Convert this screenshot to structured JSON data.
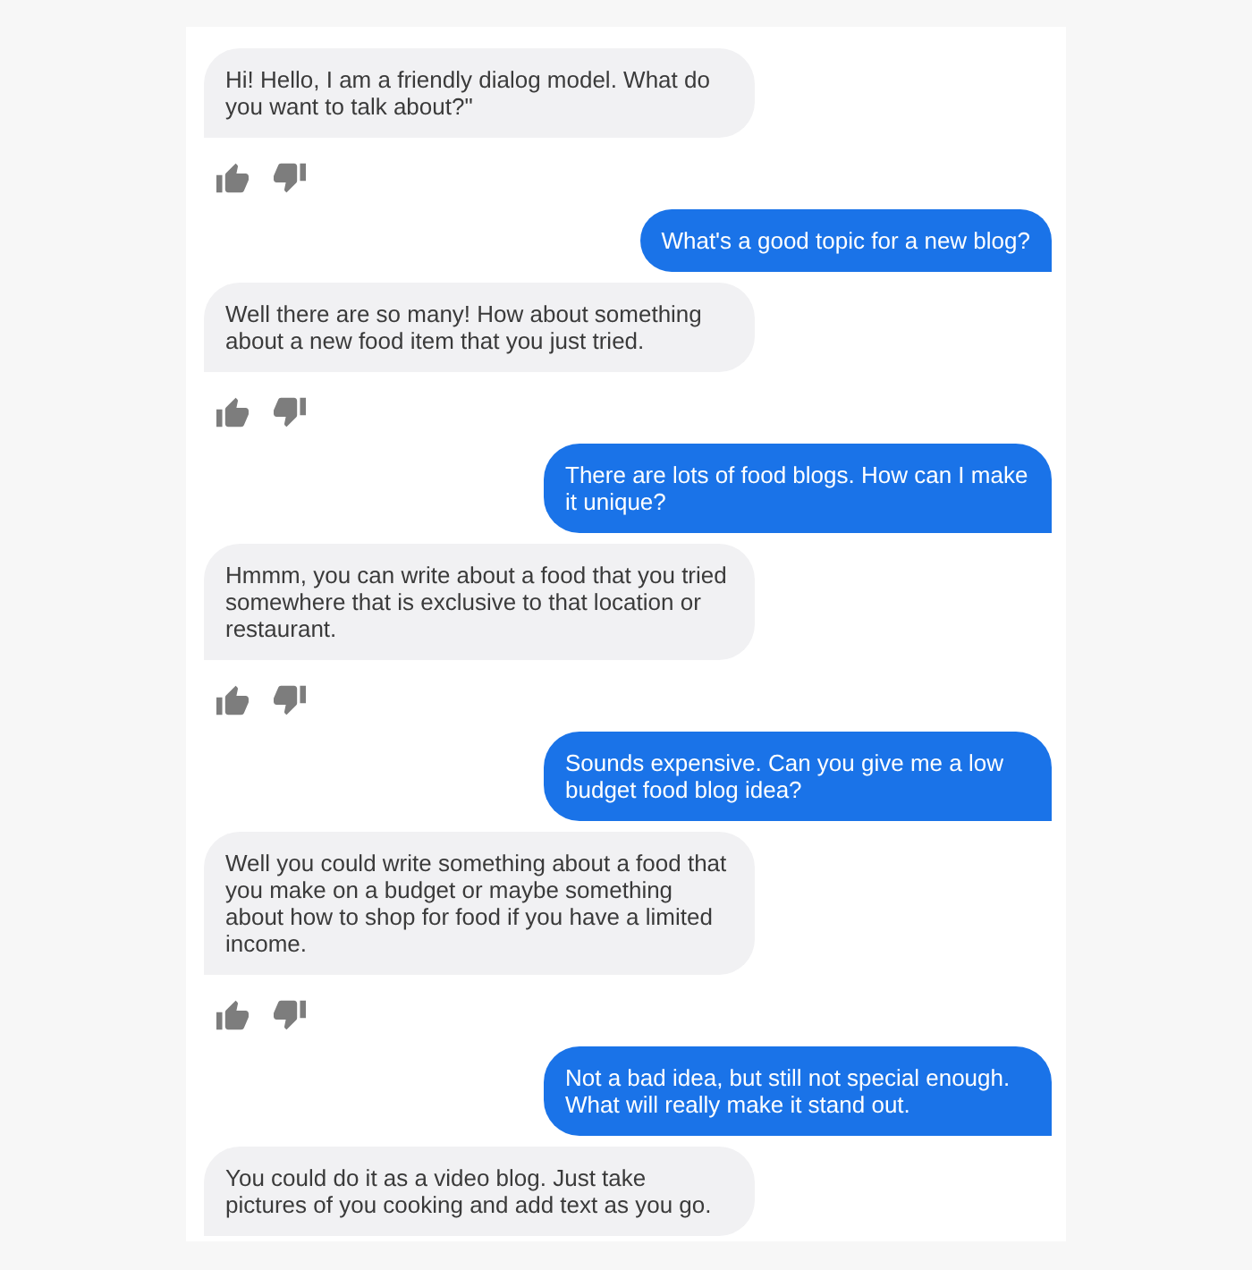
{
  "messages": [
    {
      "kind": "bot",
      "text": "Hi! Hello, I am a friendly dialog model. What do you want to talk about?\"",
      "feedback": true
    },
    {
      "kind": "user",
      "text": "What's a good topic for a new blog?"
    },
    {
      "kind": "bot",
      "text": "Well there are so many! How about something about a new food item that you just tried.",
      "feedback": true
    },
    {
      "kind": "user",
      "text": "There are lots of food blogs. How can I make it unique?"
    },
    {
      "kind": "bot",
      "text": "Hmmm, you can write about a food that you tried somewhere that is exclusive to that location or restaurant.",
      "feedback": true
    },
    {
      "kind": "user",
      "text": "Sounds expensive. Can you give me a low budget food blog idea?"
    },
    {
      "kind": "bot",
      "text": "Well you could write something about a food that you make on a budget or maybe something about how to shop for food if you have a limited income.",
      "feedback": true
    },
    {
      "kind": "user",
      "text": "Not a bad idea, but still not special enough. What will really make it stand out."
    },
    {
      "kind": "bot",
      "text": "You could do it as a video blog. Just take pictures of you cooking and add text as you go.",
      "feedback": false
    }
  ]
}
